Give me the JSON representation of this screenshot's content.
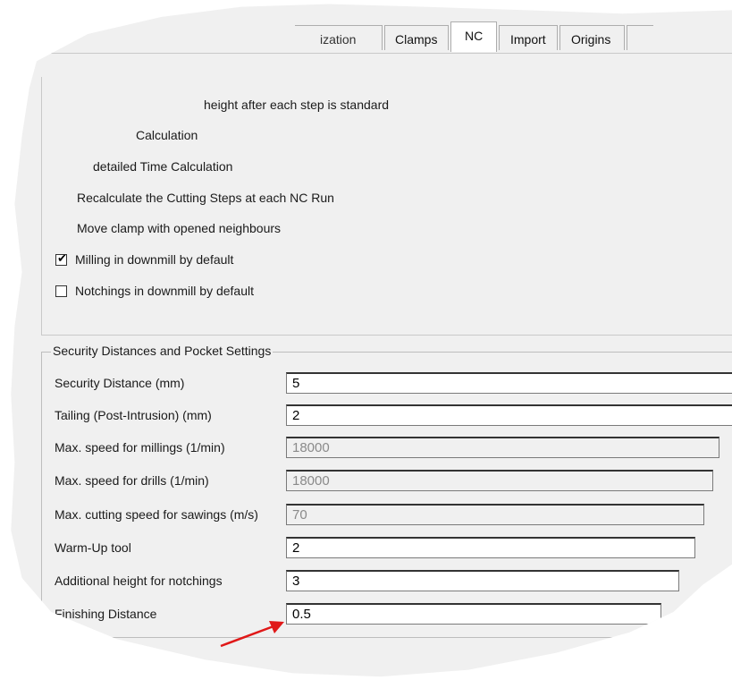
{
  "tabs": [
    {
      "label": "ization",
      "active": false
    },
    {
      "label": "Clamps",
      "active": false
    },
    {
      "label": "NC",
      "active": true
    },
    {
      "label": "Import",
      "active": false
    },
    {
      "label": "Origins",
      "active": false
    }
  ],
  "options": [
    {
      "label": "height after each step is standard",
      "checked": null
    },
    {
      "label": "Calculation",
      "checked": null
    },
    {
      "label": "detailed Time Calculation",
      "checked": null
    },
    {
      "label": "Recalculate the Cutting Steps at each NC Run",
      "checked": null
    },
    {
      "label": "Move clamp with opened neighbours",
      "checked": null
    },
    {
      "label": "Milling in downmill by default",
      "checked": true
    },
    {
      "label": "Notchings in downmill by default",
      "checked": false
    }
  ],
  "check_glyph": "✔",
  "security_group": {
    "title": "Security Distances and Pocket Settings",
    "rows": [
      {
        "label": "Security Distance (mm)",
        "value": "5",
        "enabled": true
      },
      {
        "label": "Tailing (Post-Intrusion) (mm)",
        "value": "2",
        "enabled": true
      },
      {
        "label": "Max. speed for millings (1/min)",
        "value": "18000",
        "enabled": false
      },
      {
        "label": "Max. speed for drills (1/min)",
        "value": "18000",
        "enabled": false
      },
      {
        "label": "Max. cutting speed for sawings (m/s)",
        "value": "70",
        "enabled": false
      },
      {
        "label": "Warm-Up tool",
        "value": "2",
        "enabled": true
      },
      {
        "label": "Additional height for notchings",
        "value": "3",
        "enabled": true
      },
      {
        "label": "Finishing Distance",
        "value": "0.5",
        "enabled": true
      }
    ]
  },
  "annotation": {
    "arrow_color": "#e01818"
  }
}
